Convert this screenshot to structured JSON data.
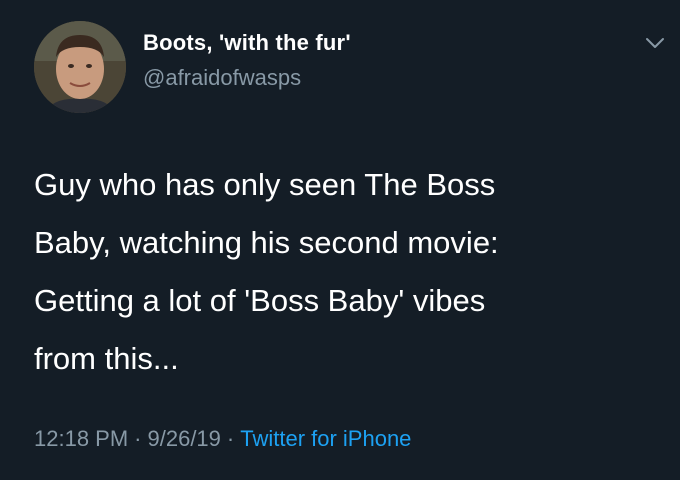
{
  "user": {
    "display_name": "Boots, 'with the fur'",
    "handle": "@afraidofwasps"
  },
  "tweet": {
    "lines": [
      "Guy who has only seen The Boss",
      "Baby, watching his second movie:",
      "Getting a lot of 'Boss Baby' vibes",
      "from this..."
    ]
  },
  "meta": {
    "time": "12:18 PM",
    "separator": "·",
    "date": "9/26/19",
    "source": "Twitter for iPhone"
  },
  "icons": {
    "caret": "chevron-down-icon",
    "avatar": "avatar"
  },
  "colors": {
    "background": "#141d26",
    "primary_text": "#ffffff",
    "secondary_text": "#8899a6",
    "link": "#1da1f2"
  }
}
